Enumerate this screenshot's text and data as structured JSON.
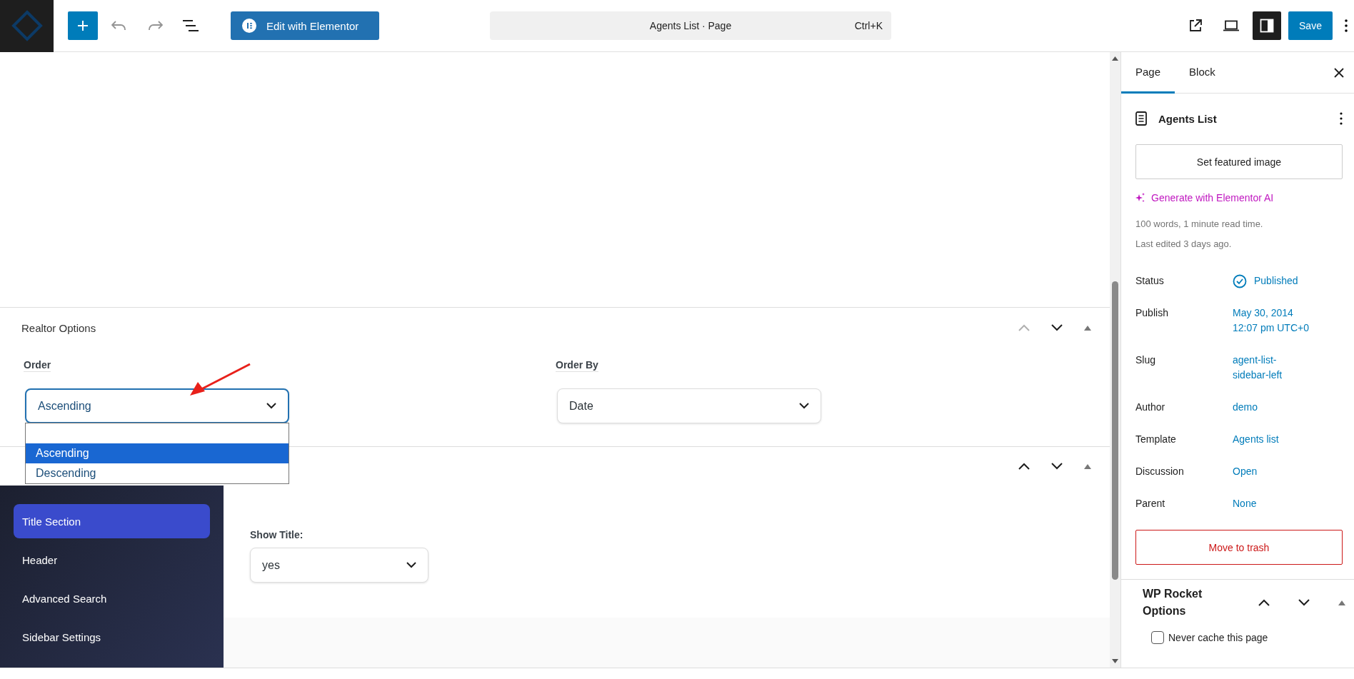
{
  "toolbar": {
    "edit_button": "Edit with Elementor",
    "command_bar": {
      "title": "Agents List · Page",
      "shortcut": "Ctrl+K"
    },
    "sidebar_toggle": {
      "on": true
    },
    "save_button": "Save"
  },
  "realtor_options": {
    "title": "Realtor Options",
    "up_disabled": true,
    "fields": [
      {
        "label": "Order",
        "value": "Ascending",
        "focused": true
      },
      {
        "label": "Order By",
        "value": "Date",
        "focused": false
      }
    ],
    "dropdown": {
      "options": [
        {
          "label": "Ascending",
          "selected": true
        },
        {
          "label": "Descending",
          "selected": false
        }
      ]
    }
  },
  "settings_box": {
    "up_disabled": false,
    "nav": [
      {
        "label": "Title Section",
        "selected": true
      },
      {
        "label": "Header",
        "selected": false
      },
      {
        "label": "Advanced Search",
        "selected": false
      },
      {
        "label": "Sidebar Settings",
        "selected": false
      }
    ],
    "field": {
      "label": "Show Title:",
      "value": "yes"
    }
  },
  "sidebar": {
    "tabs": [
      {
        "label": "Page",
        "selected": true
      },
      {
        "label": "Block",
        "selected": false
      }
    ],
    "title": "Agents List",
    "featured_button": "Set featured image",
    "ai_link": "Generate with Elementor AI",
    "stats": [
      "100 words, 1 minute read time.",
      "Last edited 3 days ago."
    ],
    "rows": [
      {
        "label": "Status",
        "kind": "status",
        "lines": [
          "Published"
        ]
      },
      {
        "label": "Publish",
        "kind": "link",
        "lines": [
          "May 30, 2014",
          "12:07 pm UTC+0"
        ]
      },
      {
        "label": "Slug",
        "kind": "link",
        "lines": [
          "agent-list-",
          "sidebar-left"
        ]
      },
      {
        "label": "Author",
        "kind": "link",
        "lines": [
          "demo"
        ]
      },
      {
        "label": "Template",
        "kind": "link",
        "lines": [
          "Agents list"
        ]
      },
      {
        "label": "Discussion",
        "kind": "link",
        "lines": [
          "Open"
        ]
      },
      {
        "label": "Parent",
        "kind": "link",
        "lines": [
          "None"
        ]
      }
    ],
    "trash_button": "Move to trash",
    "rocket": {
      "title": "WP Rocket Options",
      "option": {
        "label": "Never cache this page",
        "checked": false
      }
    }
  }
}
